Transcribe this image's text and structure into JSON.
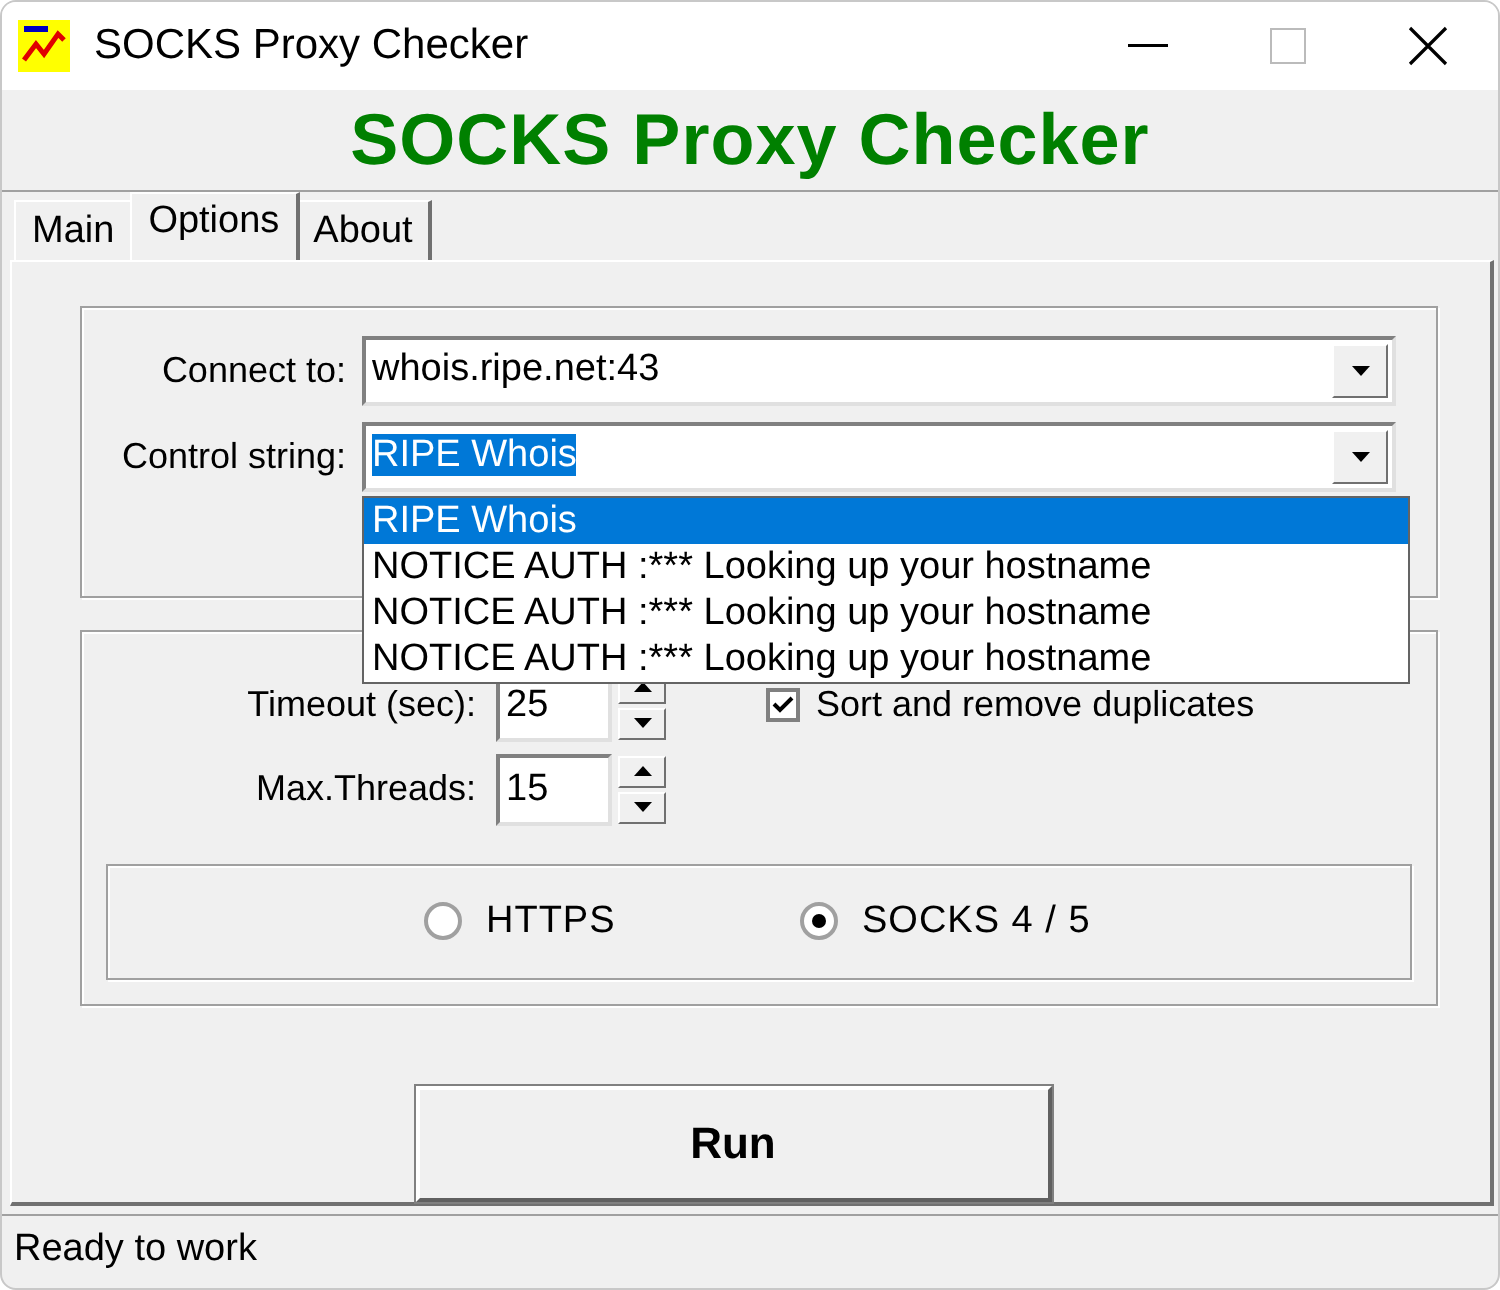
{
  "window": {
    "title": "SOCKS Proxy Checker"
  },
  "banner": "SOCKS Proxy Checker",
  "tabs": [
    {
      "label": "Main",
      "selected": false
    },
    {
      "label": "Options",
      "selected": true
    },
    {
      "label": "About",
      "selected": false
    }
  ],
  "connection": {
    "connect_label": "Connect to:",
    "connect_value": "whois.ripe.net:43",
    "control_label": "Control string:",
    "control_value": "RIPE Whois",
    "dropdown_open": true,
    "options": [
      {
        "label": "RIPE Whois",
        "selected": true
      },
      {
        "label": "NOTICE AUTH :*** Looking up your hostname",
        "selected": false
      },
      {
        "label": "NOTICE AUTH :*** Looking up your hostname",
        "selected": false
      },
      {
        "label": "NOTICE AUTH :*** Looking up your hostname",
        "selected": false
      }
    ]
  },
  "settings": {
    "timeout_label": "Timeout (sec):",
    "timeout_value": "25",
    "threads_label": "Max.Threads:",
    "threads_value": "15",
    "sort_label": "Sort and remove duplicates",
    "sort_checked": true
  },
  "protocols": [
    {
      "label": "HTTPS",
      "selected": false
    },
    {
      "label": "SOCKS 4 / 5",
      "selected": true
    }
  ],
  "run_button": "Run",
  "status_bar": "Ready to work"
}
